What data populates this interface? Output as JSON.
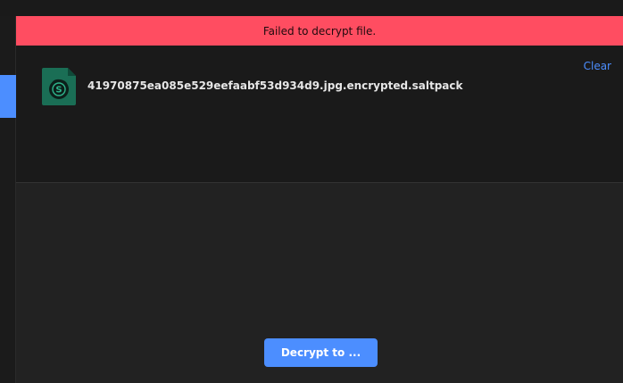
{
  "banner": {
    "message": "Failed to decrypt file."
  },
  "file": {
    "icon": "saltpack-file-icon",
    "name": "41970875ea085e529eefaabf53d934d9.jpg.encrypted.saltpack",
    "clear_label": "Clear"
  },
  "actions": {
    "decrypt_label": "Decrypt to ..."
  },
  "colors": {
    "accent": "#4c8eff",
    "error": "#ff4d61",
    "file_icon": "#1a6e55"
  }
}
